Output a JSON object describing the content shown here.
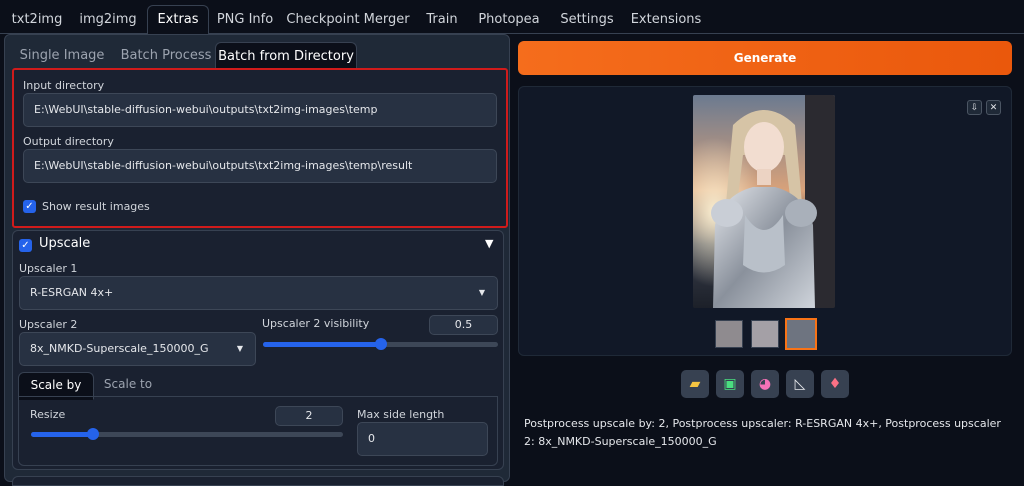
{
  "top_tabs": [
    {
      "label": "txt2img"
    },
    {
      "label": "img2img"
    },
    {
      "label": "Extras"
    },
    {
      "label": "PNG Info"
    },
    {
      "label": "Checkpoint Merger"
    },
    {
      "label": "Train"
    },
    {
      "label": "Photopea"
    },
    {
      "label": "Settings"
    },
    {
      "label": "Extensions"
    }
  ],
  "sub_tabs": [
    {
      "label": "Single Image"
    },
    {
      "label": "Batch Process"
    },
    {
      "label": "Batch from Directory"
    }
  ],
  "batch_dir": {
    "input_label": "Input directory",
    "input_value": "E:\\WebUI\\stable-diffusion-webui\\outputs\\txt2img-images\\temp",
    "output_label": "Output directory",
    "output_value": "E:\\WebUI\\stable-diffusion-webui\\outputs\\txt2img-images\\temp\\result",
    "show_result_label": "Show result images",
    "show_result_checked": true
  },
  "upscale": {
    "title": "Upscale",
    "upscaler1_label": "Upscaler 1",
    "upscaler1_value": "R-ESRGAN 4x+",
    "upscaler2_label": "Upscaler 2",
    "upscaler2_value": "8x_NMKD-Superscale_150000_G",
    "visibility_label": "Upscaler 2 visibility",
    "visibility_value": "0.5",
    "visibility_fraction": 0.5,
    "scale_tabs": [
      {
        "label": "Scale by"
      },
      {
        "label": "Scale to"
      }
    ],
    "resize_label": "Resize",
    "resize_value": "2",
    "resize_fraction": 0.2,
    "max_side_label": "Max side length",
    "max_side_value": "0"
  },
  "right": {
    "generate_label": "Generate",
    "info_text": "Postprocess upscale by: 2, Postprocess upscaler: R-ESRGAN 4x+, Postprocess upscaler 2: 8x_NMKD-Superscale_150000_G"
  },
  "icons": {
    "download": "download-icon",
    "close": "close-icon",
    "folder": "folder-icon",
    "image": "image-icon",
    "palette": "palette-icon",
    "ruler": "triangle-ruler-icon",
    "extra": "eraser-icon"
  },
  "colors": {
    "accent": "#f97316",
    "highlight_border": "#d01b1b",
    "checkbox": "#2563eb"
  }
}
